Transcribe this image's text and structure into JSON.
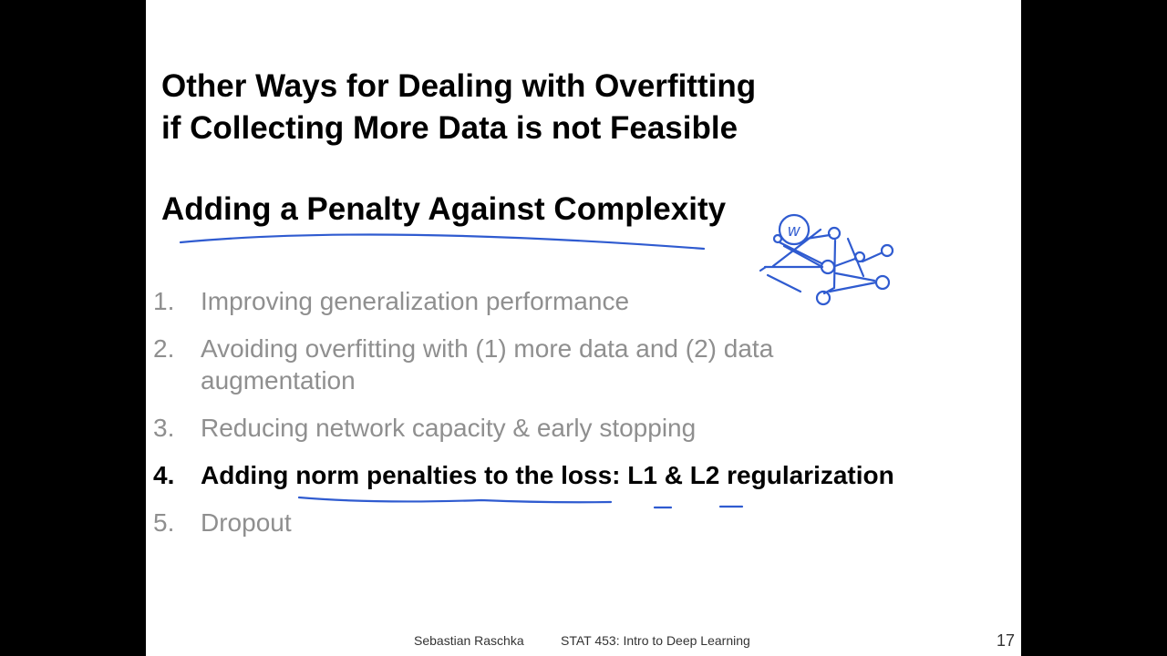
{
  "slide": {
    "title_lines": [
      "Other Ways for Dealing with Overfitting",
      "if Collecting More Data is not Feasible"
    ],
    "subtitle": "Adding a Penalty Against Complexity",
    "items": [
      {
        "number": "1.",
        "text": "Improving generalization performance",
        "active": false
      },
      {
        "number": "2.",
        "text": "Avoiding overfitting with (1) more data and (2) data augmentation",
        "active": false
      },
      {
        "number": "3.",
        "text": "Reducing network capacity & early stopping",
        "active": false
      },
      {
        "number": "4.",
        "text": "Adding norm penalties to the loss: L1 & L2 regularization",
        "active": true
      },
      {
        "number": "5.",
        "text": "Dropout",
        "active": false
      }
    ],
    "footer": {
      "author": "Sebastian Raschka",
      "course": "STAT 453: Intro to Deep Learning",
      "page": "17"
    },
    "annotation_label": "w"
  },
  "colors": {
    "ink": "#2f5bd0",
    "muted_text": "#8f8f8f",
    "active_text": "#000000",
    "background": "#000000",
    "slide": "#ffffff"
  }
}
